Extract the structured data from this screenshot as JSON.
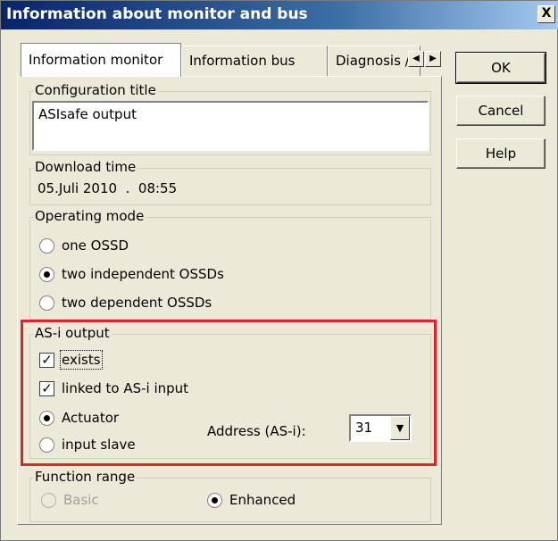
{
  "window": {
    "title": "Information about monitor and bus",
    "close_label": "X"
  },
  "tabs": [
    {
      "label": "Information monitor",
      "active": true
    },
    {
      "label": "Information bus",
      "active": false
    },
    {
      "label": "Diagnosis / S",
      "active": false
    }
  ],
  "tab_scroll": {
    "left_icon": "arrow-left-icon",
    "right_icon": "arrow-right-icon"
  },
  "config": {
    "legend": "Configuration title",
    "value": "ASIsafe output"
  },
  "download": {
    "legend": "Download time",
    "value": "05.Juli 2010  .  08:55"
  },
  "operating_mode": {
    "legend": "Operating mode",
    "options": [
      {
        "label": "one OSSD",
        "selected": false
      },
      {
        "label": "two independent OSSDs",
        "selected": true
      },
      {
        "label": "two dependent OSSDs",
        "selected": false
      }
    ]
  },
  "asi_output": {
    "legend": "AS-i output",
    "exists_label": "exists",
    "exists_checked": true,
    "linked_label": "linked to AS-i input",
    "linked_checked": true,
    "actuator_label": "Actuator",
    "actuator_selected": true,
    "input_slave_label": "input slave",
    "input_slave_selected": false,
    "address_label": "Address (AS-i):",
    "address_value": "31"
  },
  "function_range": {
    "legend": "Function range",
    "basic_label": "Basic",
    "basic_selected": false,
    "enhanced_label": "Enhanced",
    "enhanced_selected": true
  },
  "buttons": {
    "ok": "OK",
    "cancel": "Cancel",
    "help": "Help"
  },
  "colors": {
    "highlight": "#e0242a",
    "title_bar": "#0a246a"
  }
}
